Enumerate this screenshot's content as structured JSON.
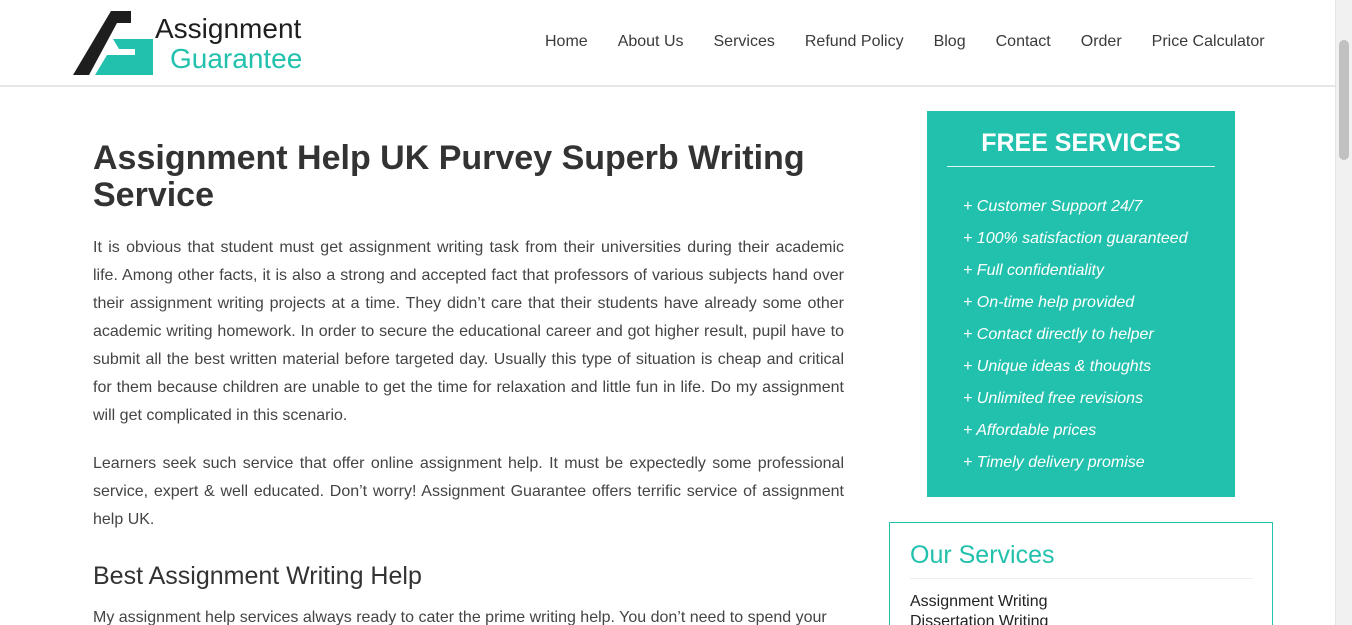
{
  "header": {
    "logo": {
      "line1": "Assignment",
      "line2": "Guarantee",
      "colors": {
        "dark": "#1e1e1e",
        "accent": "#22c1ad"
      }
    },
    "nav": [
      {
        "label": "Home"
      },
      {
        "label": "About Us"
      },
      {
        "label": "Services"
      },
      {
        "label": "Refund Policy"
      },
      {
        "label": "Blog"
      },
      {
        "label": "Contact"
      },
      {
        "label": "Order"
      },
      {
        "label": "Price Calculator"
      }
    ]
  },
  "main": {
    "title": "Assignment Help UK Purvey Superb Writing Service",
    "paragraphs": [
      "It is obvious that student must get assignment writing task from their universities during their academic life. Among other facts, it is also a strong and accepted fact that professors of various subjects hand over their assignment writing projects at a time. They didn’t care that their students have already some other academic writing homework. In order to secure the educational career and got higher result, pupil have to submit all the best written material before targeted day. Usually this type of situation is cheap and critical for them because children are unable to get the time for relaxation and little fun in life. Do my assignment will get complicated in this scenario.",
      "Learners seek such service that offer online assignment help. It must be expectedly some professional service, expert & well educated. Don’t worry! Assignment Guarantee offers terrific service of assignment help UK."
    ],
    "section_heading": "Best Assignment Writing Help",
    "section_paragraph": "My assignment help services always ready to cater the prime writing help. You don’t need to spend your"
  },
  "sidebar": {
    "free_services": {
      "title": "FREE SERVICES",
      "items": [
        "+ Customer Support 24/7",
        "+ 100% satisfaction guaranteed",
        "+ Full confidentiality",
        "+ On-time help provided",
        "+ Contact directly to helper",
        "+ Unique ideas & thoughts",
        "+ Unlimited free revisions",
        "+ Affordable prices",
        "+ Timely delivery promise"
      ]
    },
    "our_services": {
      "title": "Our Services",
      "items": [
        "Assignment Writing",
        "Dissertation Writing"
      ]
    }
  },
  "colors": {
    "accent": "#22c1ad",
    "text": "#333333"
  }
}
